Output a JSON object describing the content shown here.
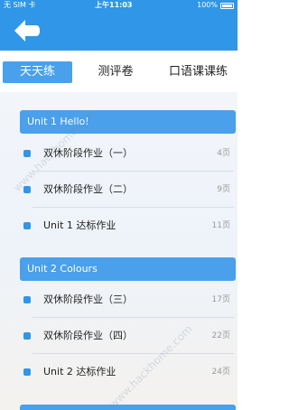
{
  "status_bar": {
    "carrier": "无 SIM 卡",
    "time": "上午11:03",
    "battery": "100%"
  },
  "nav": {
    "back_icon": "back-arrow-icon"
  },
  "tabs": [
    {
      "label": "天天练",
      "active": true
    },
    {
      "label": "测评卷",
      "active": false
    },
    {
      "label": "口语课课练",
      "active": false
    }
  ],
  "sections": [
    {
      "title": "Unit 1 Hello!",
      "items": [
        {
          "title": "双休阶段作业（一）",
          "pages": "4页"
        },
        {
          "title": "双休阶段作业（二）",
          "pages": "9页"
        },
        {
          "title": "Unit 1 达标作业",
          "pages": "11页"
        }
      ]
    },
    {
      "title": "Unit 2 Colours",
      "items": [
        {
          "title": "双休阶段作业（三）",
          "pages": "17页"
        },
        {
          "title": "双休阶段作业（四）",
          "pages": "22页"
        },
        {
          "title": "Unit 2 达标作业",
          "pages": "24页"
        }
      ]
    }
  ],
  "watermarks": [
    "www.hackhome.com",
    "www.hackhome.com"
  ],
  "colors": {
    "primary": "#2f96e8",
    "header": "#4aa0ea",
    "dot": "#2f96e8"
  }
}
